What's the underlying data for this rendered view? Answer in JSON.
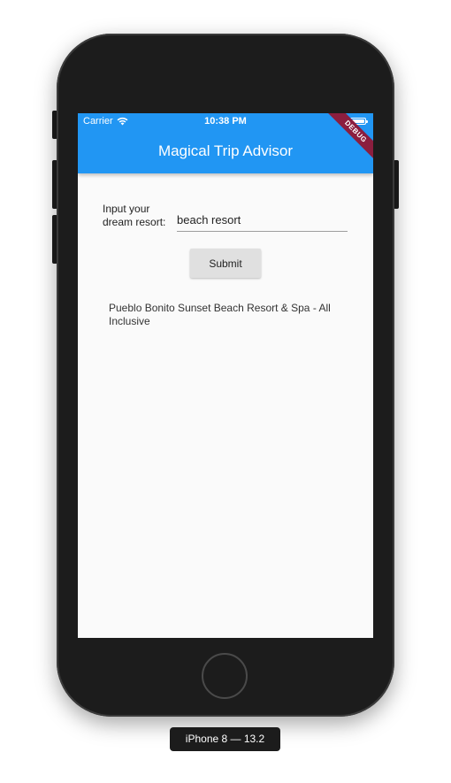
{
  "status_bar": {
    "carrier": "Carrier",
    "time": "10:38 PM",
    "wifi_icon": "wifi-icon",
    "battery_icon": "battery-icon"
  },
  "app_bar": {
    "title": "Magical Trip Advisor",
    "color": "#2196f3",
    "debug_banner": "DEBUG"
  },
  "form": {
    "label_line1": "Input your",
    "label_line2": "dream resort:",
    "input_value": "beach resort",
    "submit_label": "Submit"
  },
  "result": {
    "text": "Pueblo Bonito Sunset Beach Resort & Spa - All Inclusive"
  },
  "device": {
    "label": "iPhone 8 — 13.2"
  }
}
